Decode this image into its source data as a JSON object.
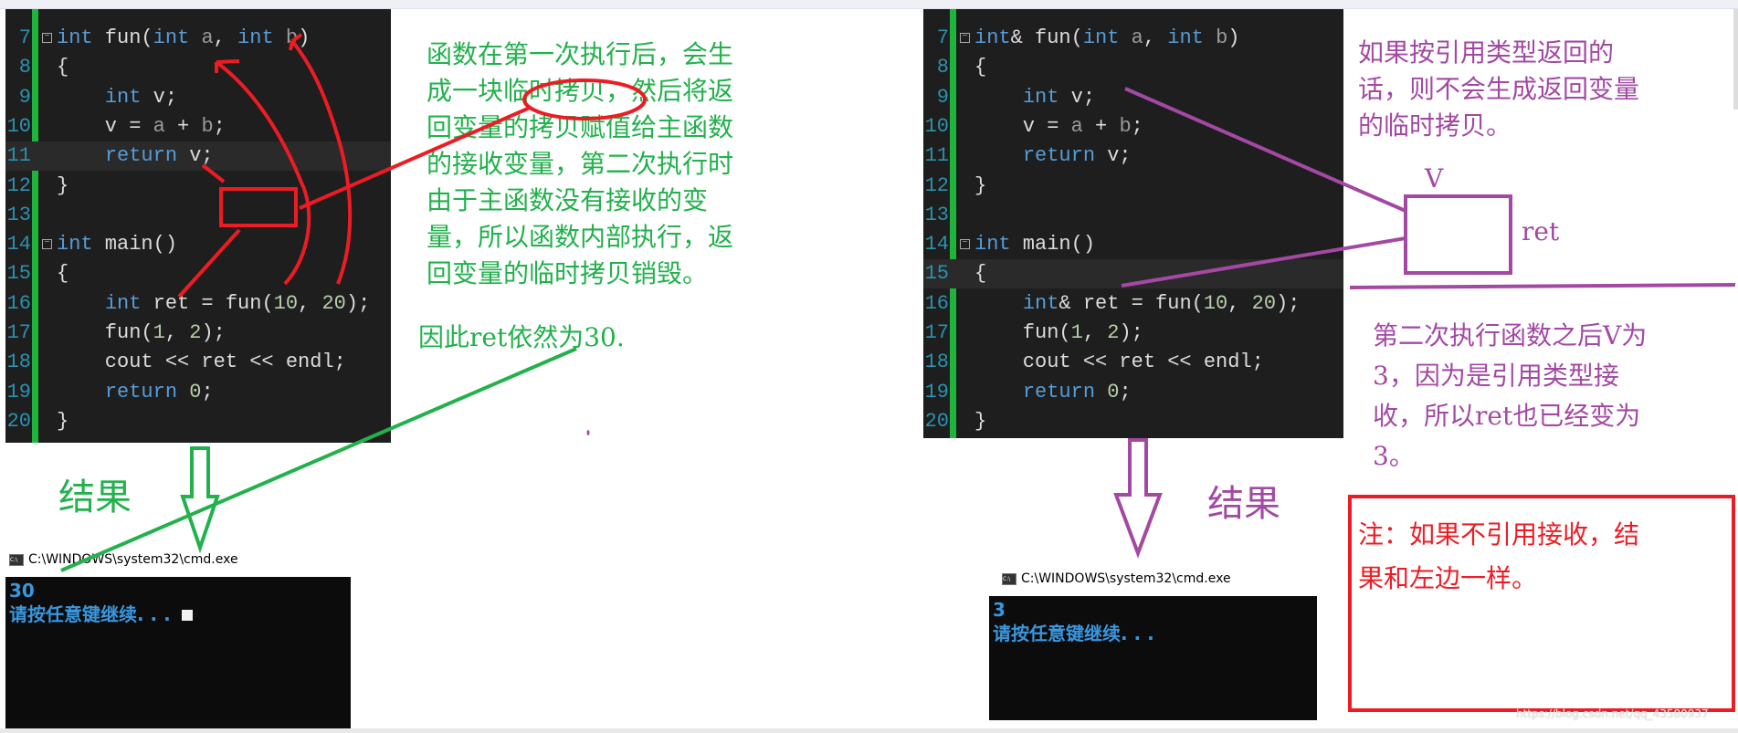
{
  "left_editor": {
    "lines": [
      {
        "n": "7",
        "html": "<span class='kw'>int</span> fun(<span class='kw'>int</span> <span class='pm'>a</span>, <span class='kw'>int</span> <span class='pm'>b</span>)"
      },
      {
        "n": "8",
        "html": "{"
      },
      {
        "n": "9",
        "html": "    <span class='kw'>int</span> v;"
      },
      {
        "n": "10",
        "html": "    v = <span class='pm'>a</span> + <span class='pm'>b</span>;"
      },
      {
        "n": "11",
        "html": "    <span class='kw'>return</span> v;"
      },
      {
        "n": "12",
        "html": "}"
      },
      {
        "n": "13",
        "html": ""
      },
      {
        "n": "14",
        "html": "<span class='kw'>int</span> main()"
      },
      {
        "n": "15",
        "html": "{"
      },
      {
        "n": "16",
        "html": "    <span class='kw'>int</span> ret = fun(<span class='nm'>10</span>, <span class='nm'>20</span>);"
      },
      {
        "n": "17",
        "html": "    fun(<span class='nm'>1</span>, <span class='nm'>2</span>);"
      },
      {
        "n": "18",
        "html": "    cout &lt;&lt; ret &lt;&lt; endl;"
      },
      {
        "n": "19",
        "html": "    <span class='kw'>return</span> <span class='nm'>0</span>;"
      },
      {
        "n": "20",
        "html": "}"
      }
    ]
  },
  "right_editor": {
    "lines": [
      {
        "n": "7",
        "html": "<span class='kw'>int</span>&amp; fun(<span class='kw'>int</span> <span class='pm'>a</span>, <span class='kw'>int</span> <span class='pm'>b</span>)"
      },
      {
        "n": "8",
        "html": "{"
      },
      {
        "n": "9",
        "html": "    <span class='kw'>int</span> v;"
      },
      {
        "n": "10",
        "html": "    v = <span class='pm'>a</span> + <span class='pm'>b</span>;"
      },
      {
        "n": "11",
        "html": "    <span class='kw'>return</span> v;"
      },
      {
        "n": "12",
        "html": "}"
      },
      {
        "n": "13",
        "html": ""
      },
      {
        "n": "14",
        "html": "<span class='kw'>int</span> main()"
      },
      {
        "n": "15",
        "html": "{"
      },
      {
        "n": "16",
        "html": "    <span class='kw'>int</span>&amp; ret = fun(<span class='nm'>10</span>, <span class='nm'>20</span>);"
      },
      {
        "n": "17",
        "html": "    fun(<span class='nm'>1</span>, <span class='nm'>2</span>);"
      },
      {
        "n": "18",
        "html": "    cout &lt;&lt; ret &lt;&lt; endl;"
      },
      {
        "n": "19",
        "html": "    <span class='kw'>return</span> <span class='nm'>0</span>;"
      },
      {
        "n": "20",
        "html": "}"
      }
    ]
  },
  "notes": {
    "left_explain": [
      "函数在第一次执行后，会生",
      "成一块临时拷贝，然后将返",
      "回变量的拷贝赋值给主函数",
      "的接收变量，第二次执行时",
      "由于主函数没有接收的变",
      "量，所以函数内部执行，返",
      "回变量的临时拷贝销毁。"
    ],
    "left_conclusion": "因此ret依然为30.",
    "left_result": "结果",
    "right_explain": [
      "如果按引用类型返回的",
      "话，则不会生成返回变量",
      "的临时拷贝。"
    ],
    "box_label_top": "V",
    "box_label_right": "ret",
    "right_explain2": [
      "第二次执行函数之后V为",
      "3，因为是引用类型接",
      "收，所以ret也已经变为",
      "3。"
    ],
    "right_result": "结果",
    "note_box": [
      "注：如果不引用接收，结",
      "果和左边一样。"
    ]
  },
  "left_cmd": {
    "title": "C:\\WINDOWS\\system32\\cmd.exe",
    "output": "30",
    "prompt": "请按任意键继续. . ."
  },
  "right_cmd": {
    "title": "C:\\WINDOWS\\system32\\cmd.exe",
    "output": "3",
    "prompt": "请按任意键继续. . ."
  },
  "watermark": "https://blog.csdn.net/qq_43580937",
  "colors": {
    "green": "#22b14c",
    "purple": "#a349a4",
    "red": "#ed1c24",
    "editor_bg": "#1e1e1e",
    "keyword": "#569cd6"
  }
}
